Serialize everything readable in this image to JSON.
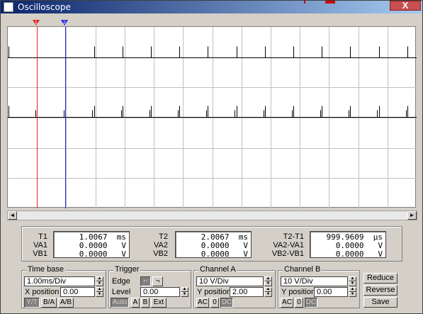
{
  "window": {
    "title": "Oscilloscope",
    "close_label": "X"
  },
  "colors": {
    "cursor1": "#e02020",
    "cursor2": "#2020e0",
    "trace": "#000000",
    "grid": "#c0c0c0",
    "screen_bg": "#ffffff"
  },
  "cursors": {
    "t1_label": "1",
    "t2_label": "2"
  },
  "readouts": {
    "col1": {
      "labels": [
        "T1",
        "VA1",
        "VB1"
      ],
      "values": [
        "1.0067  ms",
        "0.0000   V",
        "0.0000   V"
      ]
    },
    "col2": {
      "labels": [
        "T2",
        "VA2",
        "VB2"
      ],
      "values": [
        "2.0067  ms",
        "0.0000   V",
        "0.0000   V"
      ]
    },
    "col3": {
      "labels": [
        "T2-T1",
        "VA2-VA1",
        "VB2-VB1"
      ],
      "values": [
        "999.9609  μs",
        "0.0000   V",
        "0.0000   V"
      ]
    }
  },
  "timebase": {
    "title": "Time base",
    "scale": "1.00ms/Div",
    "xpos_label": "X position",
    "xpos": "0.00",
    "buttons": [
      "Y/T",
      "B/A",
      "A/B"
    ]
  },
  "trigger": {
    "title": "Trigger",
    "edge_label": "Edge",
    "level_label": "Level",
    "level": "0.00",
    "buttons": [
      "Auto",
      "A",
      "B",
      "Ext"
    ]
  },
  "channel_a": {
    "title": "Channel A",
    "scale": "10 V/Div",
    "ypos_label": "Y position",
    "ypos": "2.00",
    "coupling": [
      "AC",
      "0",
      "DC"
    ]
  },
  "channel_b": {
    "title": "Channel B",
    "scale": "10 V/Div",
    "ypos_label": "Y position",
    "ypos": "0.00",
    "coupling": [
      "AC",
      "0",
      "DC"
    ]
  },
  "side_buttons": [
    "Reduce",
    "Reverse",
    "Save"
  ],
  "scrollbar": {
    "left_arrow": "◄",
    "right_arrow": "►"
  }
}
